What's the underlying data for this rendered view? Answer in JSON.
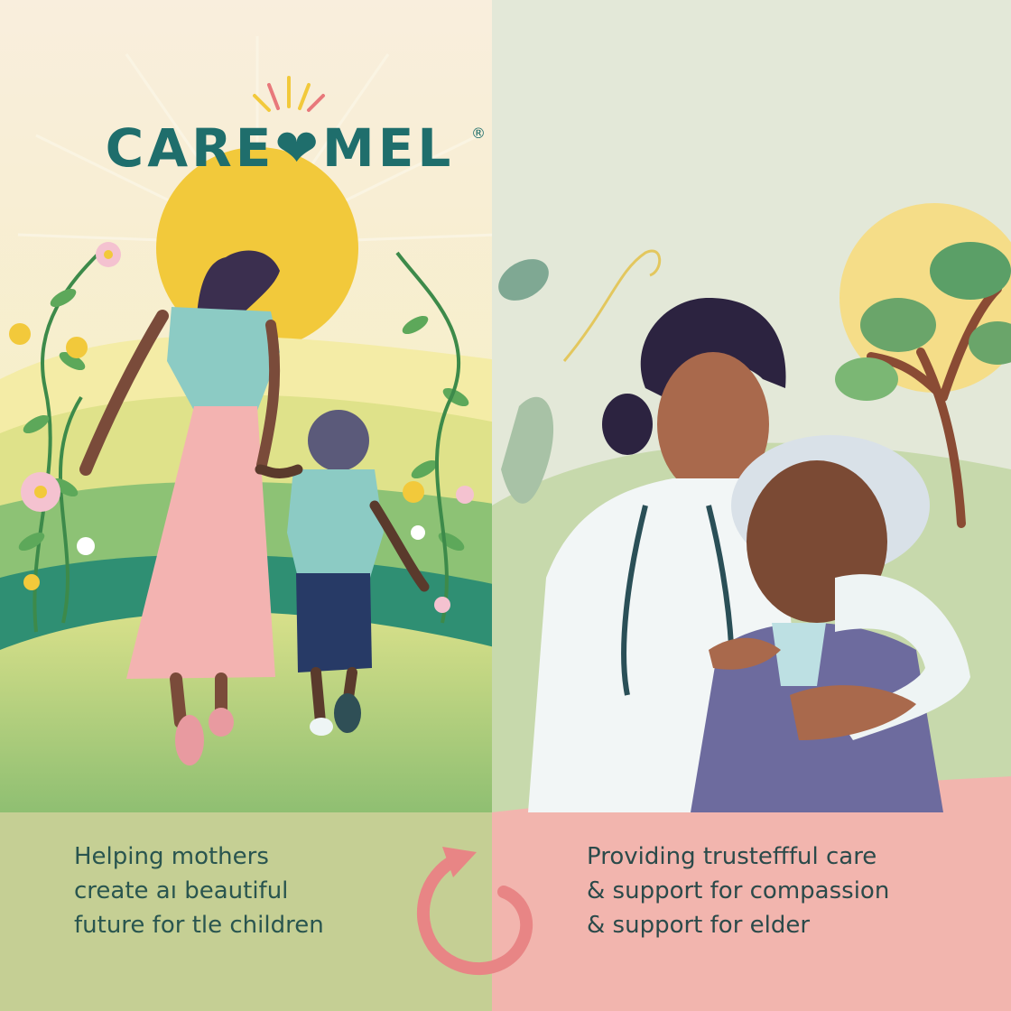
{
  "brand": {
    "name": "CARE❤MEL",
    "registered_mark": "®"
  },
  "left_panel": {
    "caption_lines": [
      "Helping mothers",
      "create aı beautiful",
      "future for tle children"
    ]
  },
  "right_panel": {
    "caption_lines": [
      "Providing trusteffful care",
      "& support for compassion",
      "& support for elder"
    ]
  },
  "icons": {
    "brand_sunburst": "sunburst-icon",
    "cycle": "circular-arrow-icon"
  },
  "colors": {
    "brand_teal": "#1f6e6c",
    "heart_coral": "#e8787b",
    "sun_yellow": "#f2c93b",
    "left_caption": "#29554f",
    "right_caption_bg": "#f2b5ae",
    "left_caption_bg": "#c5cf94",
    "arrow": "#e88585"
  }
}
